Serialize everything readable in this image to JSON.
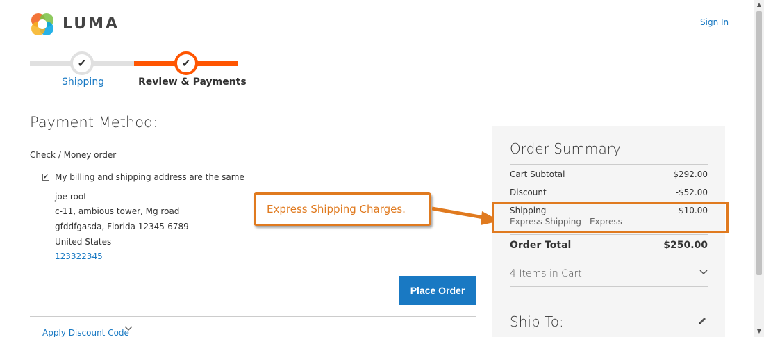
{
  "header": {
    "logo_text": "LUMA",
    "sign_in": "Sign In"
  },
  "progress": {
    "steps": [
      {
        "label": "Shipping",
        "done": true
      },
      {
        "label": "Review & Payments",
        "active": true
      }
    ],
    "check_glyph": "✔"
  },
  "payment": {
    "title": "Payment Method:",
    "method": "Check / Money order",
    "same_address_label": "My billing and shipping address are the same",
    "same_address_checked": true,
    "address": {
      "name": "joe root",
      "street": "c-11, ambious tower, Mg road",
      "city": "gfddfgasda, Florida 12345-6789",
      "country": "United States",
      "phone": "123322345"
    },
    "place_order": "Place Order",
    "apply_discount": "Apply Discount Code"
  },
  "callout": {
    "text": "Express Shipping Charges."
  },
  "summary": {
    "title": "Order Summary",
    "rows": {
      "subtotal": {
        "label": "Cart Subtotal",
        "value": "$292.00"
      },
      "discount": {
        "label": "Discount",
        "value": "-$52.00"
      },
      "shipping": {
        "label": "Shipping",
        "value": "$10.00",
        "method": "Express Shipping - Express"
      }
    },
    "total": {
      "label": "Order Total",
      "value": "$250.00"
    },
    "items_in_cart": "4 Items in Cart",
    "ship_to": "Ship To:"
  },
  "colors": {
    "accent": "#ff5501",
    "link": "#1979c3",
    "callout": "#e07a1f"
  },
  "icons": {
    "logo": "luma-logo-icon",
    "chevron": "chevron-down-icon",
    "edit": "pencil-icon"
  }
}
